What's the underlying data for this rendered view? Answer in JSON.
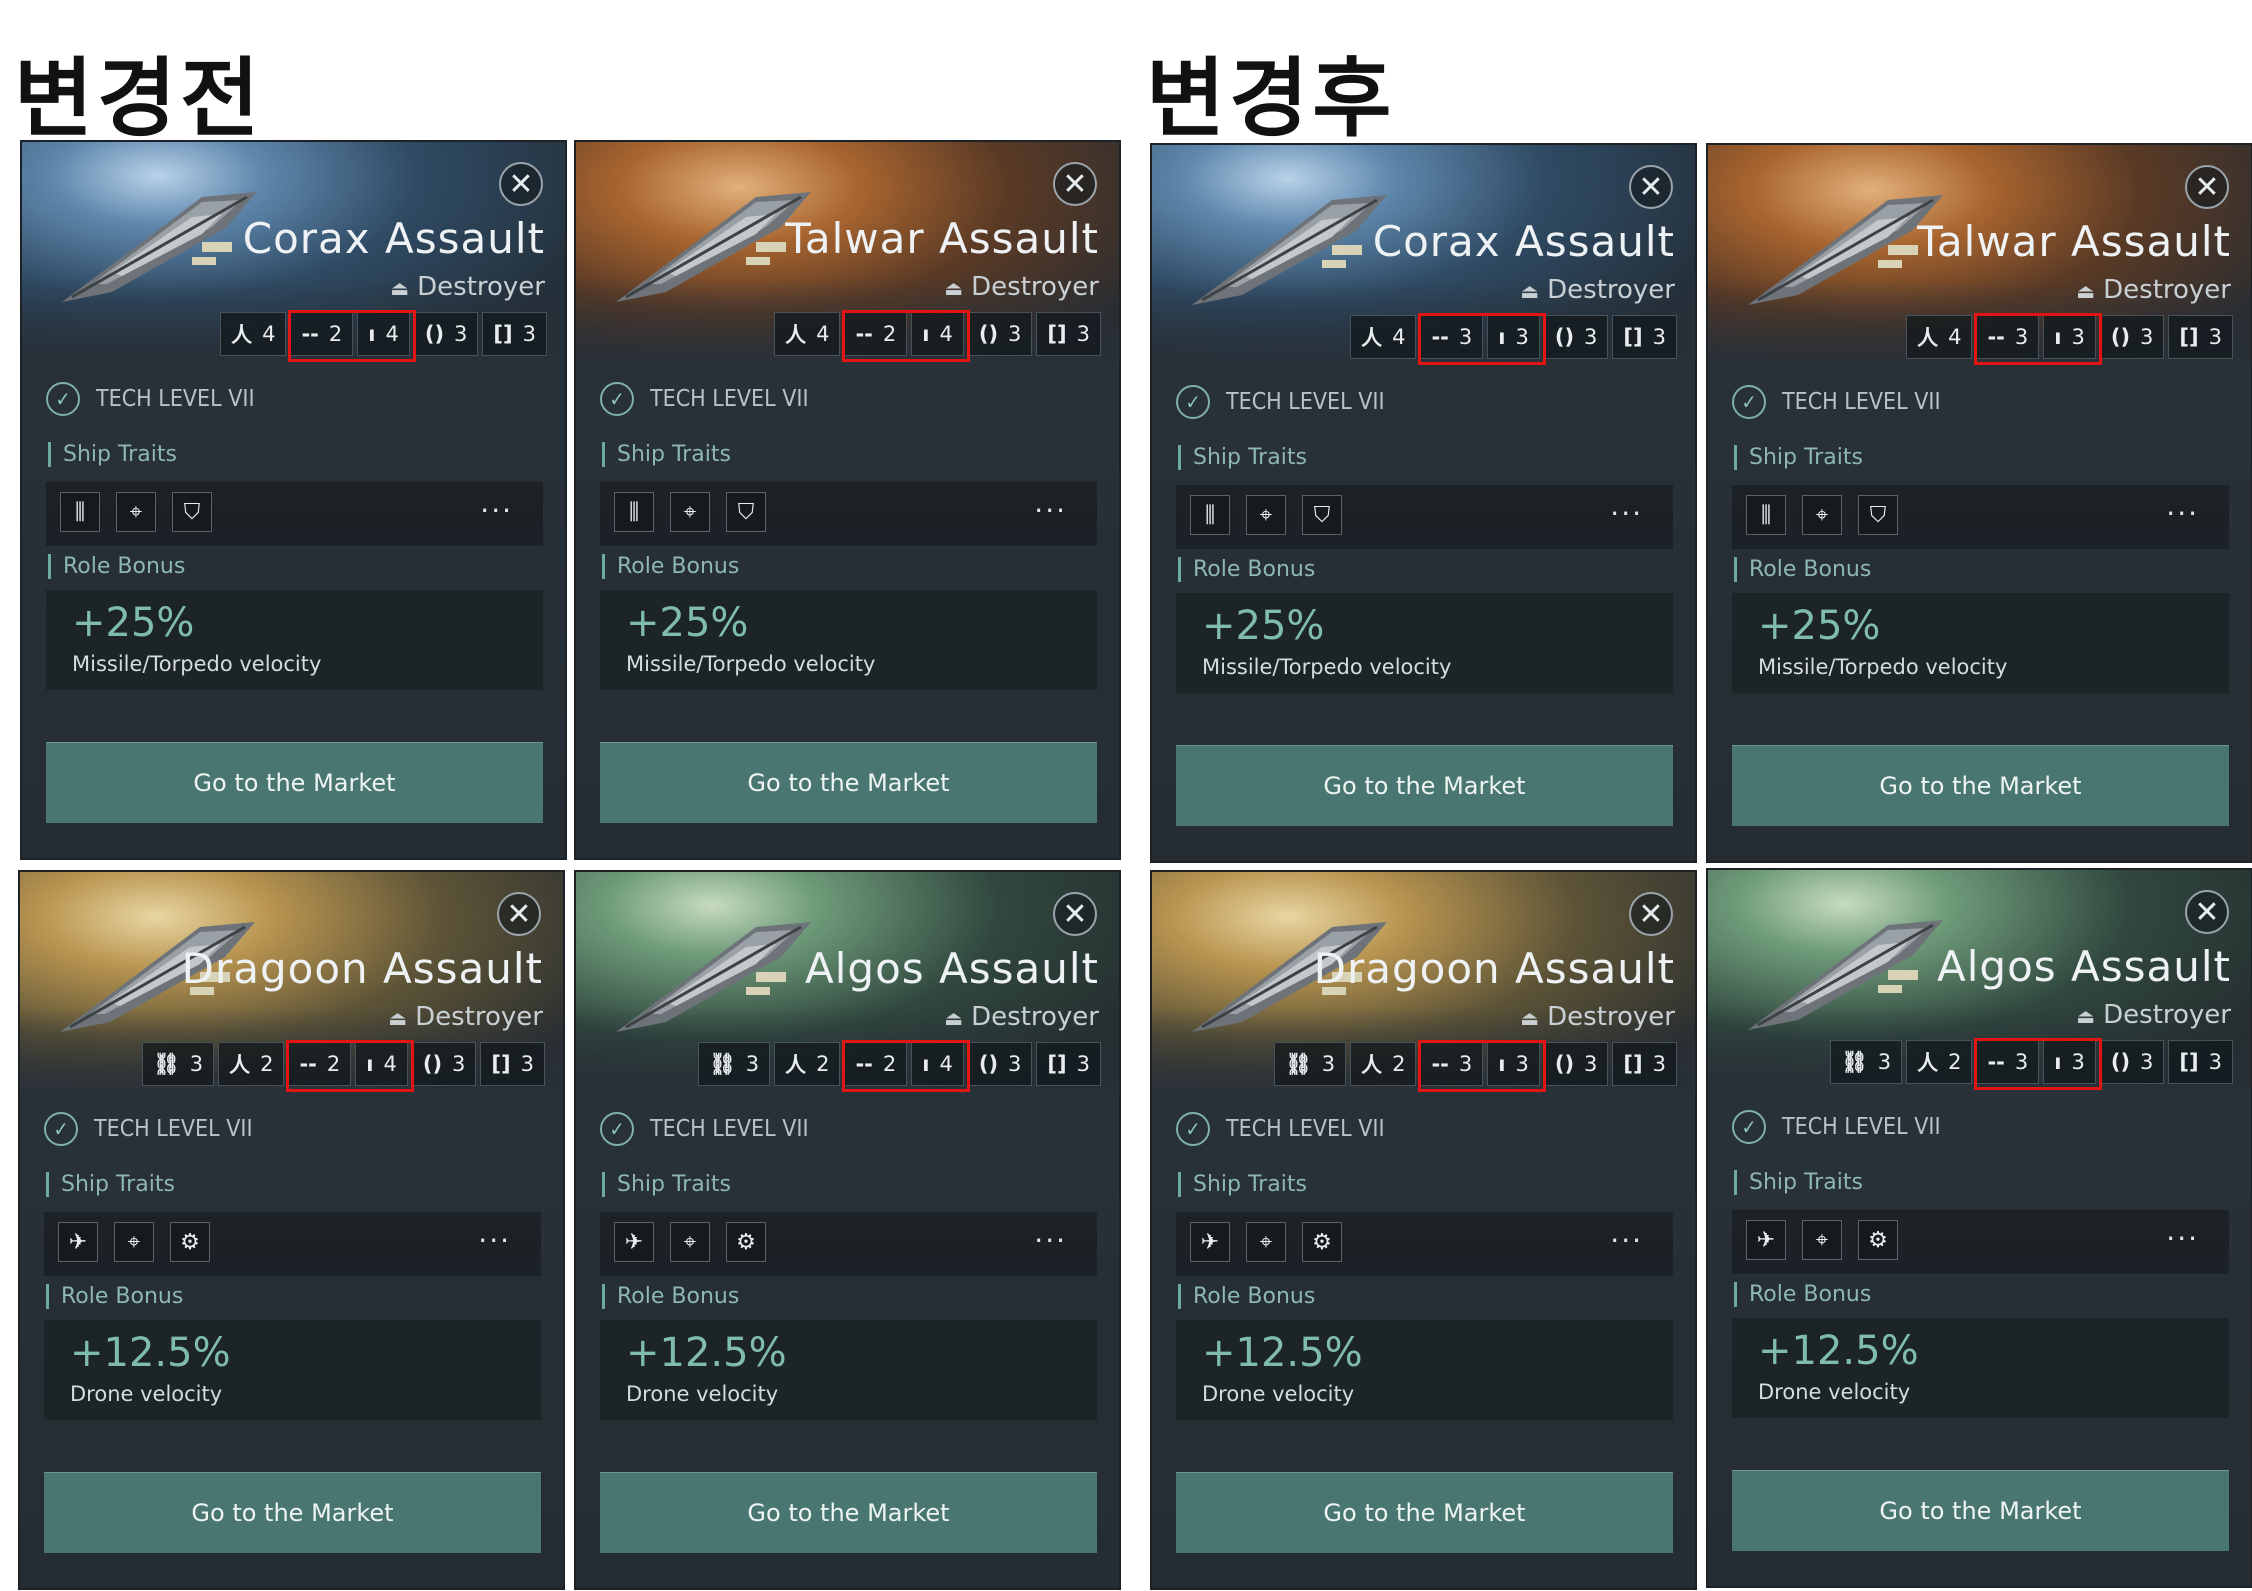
{
  "headings": {
    "before": "변경전",
    "after": "변경후"
  },
  "labels": {
    "tech_level": "TECH LEVEL VII",
    "ship_traits": "Ship Traits",
    "role_bonus": "Role Bonus",
    "market_button": "Go to the Market",
    "more": "···",
    "close": "✕"
  },
  "colors": {
    "highlight": "#e21414",
    "accent": "#4a7672",
    "bonus_text": "#7fbcac"
  },
  "cards": [
    {
      "name": "Corax Assault",
      "class": "Destroyer",
      "slots": [
        "4",
        "2",
        "4",
        "3",
        "3"
      ],
      "bonus_value": "+25%",
      "bonus_desc": "Missile/Torpedo velocity"
    },
    {
      "name": "Talwar Assault",
      "class": "Destroyer",
      "slots": [
        "4",
        "2",
        "4",
        "3",
        "3"
      ],
      "bonus_value": "+25%",
      "bonus_desc": "Missile/Torpedo velocity"
    },
    {
      "name": "Corax Assault",
      "class": "Destroyer",
      "slots": [
        "4",
        "3",
        "3",
        "3",
        "3"
      ],
      "bonus_value": "+25%",
      "bonus_desc": "Missile/Torpedo velocity"
    },
    {
      "name": "Talwar Assault",
      "class": "Destroyer",
      "slots": [
        "4",
        "3",
        "3",
        "3",
        "3"
      ],
      "bonus_value": "+25%",
      "bonus_desc": "Missile/Torpedo velocity"
    },
    {
      "name": "Dragoon Assault",
      "class": "Destroyer",
      "slots": [
        "3",
        "2",
        "2",
        "4",
        "3",
        "3"
      ],
      "bonus_value": "+12.5%",
      "bonus_desc": "Drone velocity"
    },
    {
      "name": "Algos Assault",
      "class": "Destroyer",
      "slots": [
        "3",
        "2",
        "2",
        "4",
        "3",
        "3"
      ],
      "bonus_value": "+12.5%",
      "bonus_desc": "Drone velocity"
    },
    {
      "name": "Dragoon Assault",
      "class": "Destroyer",
      "slots": [
        "3",
        "2",
        "3",
        "3",
        "3",
        "3"
      ],
      "bonus_value": "+12.5%",
      "bonus_desc": "Drone velocity"
    },
    {
      "name": "Algos Assault",
      "class": "Destroyer",
      "slots": [
        "3",
        "2",
        "3",
        "3",
        "3",
        "3"
      ],
      "bonus_value": "+12.5%",
      "bonus_desc": "Drone velocity"
    }
  ]
}
